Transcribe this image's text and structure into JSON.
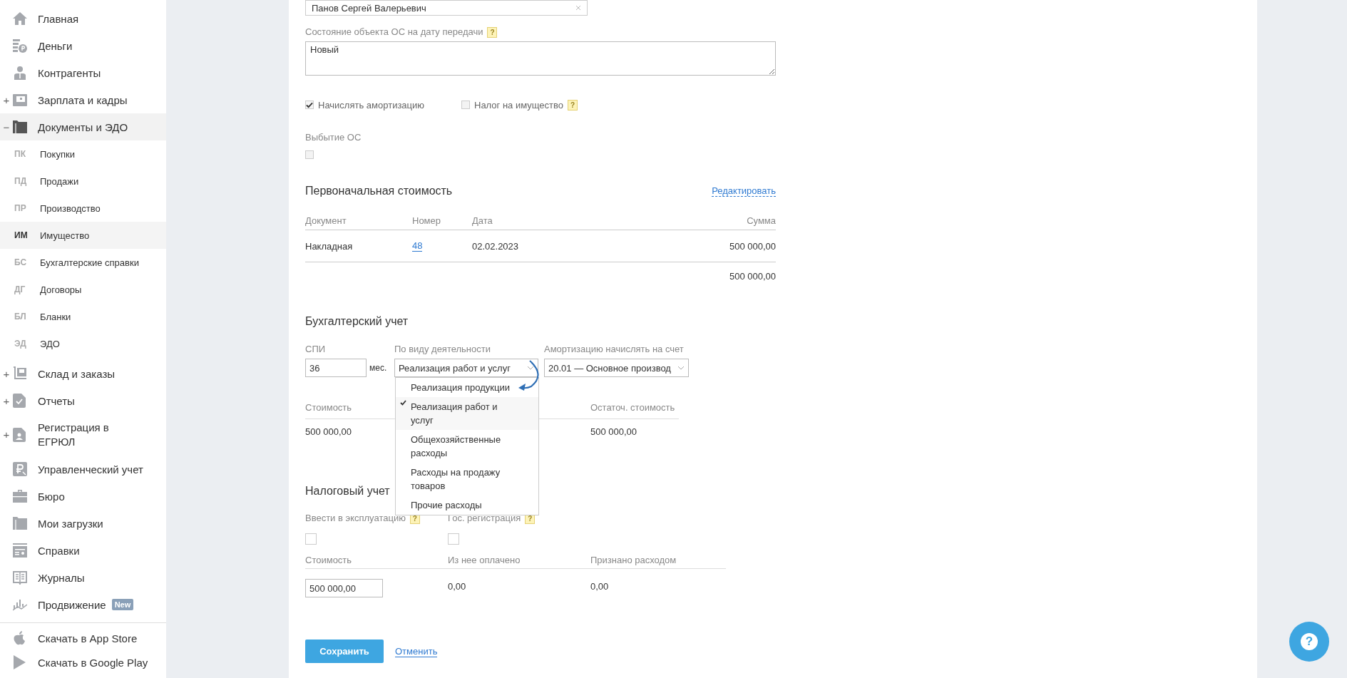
{
  "sidebar": {
    "items": [
      {
        "label": "Главная"
      },
      {
        "label": "Деньги"
      },
      {
        "label": "Контрагенты"
      },
      {
        "label": "Зарплата и кадры",
        "toggle": "+",
        "expanded": false
      },
      {
        "label": "Документы и ЭДО",
        "toggle": "−",
        "expanded": true,
        "children": [
          {
            "abbr": "ПК",
            "label": "Покупки",
            "selected": false
          },
          {
            "abbr": "ПД",
            "label": "Продажи",
            "selected": false
          },
          {
            "abbr": "ПР",
            "label": "Производство",
            "selected": false
          },
          {
            "abbr": "ИМ",
            "label": "Имущество",
            "selected": true
          },
          {
            "abbr": "БС",
            "label": "Бухгалтерские справки",
            "selected": false
          },
          {
            "abbr": "ДГ",
            "label": "Договоры",
            "selected": false
          },
          {
            "abbr": "БЛ",
            "label": "Бланки",
            "selected": false
          },
          {
            "abbr": "ЭД",
            "label": "ЭДО",
            "selected": false
          }
        ]
      },
      {
        "label": "Склад и заказы",
        "toggle": "+",
        "expanded": false
      },
      {
        "label": "Отчеты",
        "toggle": "+",
        "expanded": false
      },
      {
        "label": "Регистрация в ЕГРЮЛ",
        "toggle": "+",
        "expanded": false
      },
      {
        "label": "Управленческий учет"
      },
      {
        "label": "Бюро"
      },
      {
        "label": "Мои загрузки"
      },
      {
        "label": "Справки"
      },
      {
        "label": "Журналы"
      },
      {
        "label": "Продвижение",
        "badge": "New"
      }
    ],
    "store_links": [
      {
        "label": "Скачать в App Store"
      },
      {
        "label": "Скачать в Google Play"
      }
    ]
  },
  "form": {
    "responsible_field": {
      "value": "Панов Сергей Валерьевич"
    },
    "condition": {
      "label": "Состояние объекта ОС на дату передачи",
      "help": "?",
      "value": "Новый"
    },
    "options": [
      {
        "label": "Начислять амортизацию",
        "checked": true
      },
      {
        "label": "Налог на имущество",
        "checked": false,
        "help": "?"
      }
    ],
    "disposal": {
      "label": "Выбытие ОС",
      "checked": false
    },
    "initial_cost": {
      "title": "Первоначальная стоимость",
      "edit_link": "Редактировать",
      "columns": [
        "Документ",
        "Номер",
        "Дата",
        "Сумма"
      ],
      "rows": [
        {
          "document": "Накладная",
          "number": "48",
          "date": "02.02.2023",
          "sum": "500 000,00"
        }
      ],
      "total": "500 000,00"
    },
    "accounting": {
      "title": "Бухгалтерский учет",
      "spi": {
        "label": "СПИ",
        "value": "36",
        "unit": "мес."
      },
      "activity": {
        "label": "По виду деятельности",
        "value": "Реализация работ и услуг",
        "expanded": true,
        "options": [
          {
            "label": "Реализация продукции",
            "selected": false
          },
          {
            "label": "Реализация работ и услуг",
            "selected": true
          },
          {
            "label": "Общехозяйственные расходы",
            "selected": false
          },
          {
            "label": "Расходы на продажу товаров",
            "selected": false
          },
          {
            "label": "Прочие расходы",
            "selected": false
          }
        ]
      },
      "account": {
        "label": "Амортизацию начислять на счет",
        "value": "20.01 — Основное производ"
      },
      "columns": [
        "Стоимость",
        "Остаточ. стоимость"
      ],
      "values": [
        "500 000,00",
        "500 000,00"
      ]
    },
    "tax": {
      "title": "Налоговый учет",
      "checks": [
        {
          "label": "Ввести в эксплуатацию",
          "help": "?",
          "checked": false
        },
        {
          "label": "Гос. регистрация",
          "help": "?",
          "checked": false
        }
      ],
      "columns": [
        "Стоимость",
        "Из нее оплачено",
        "Признано расходом"
      ],
      "cost_value": "500 000,00",
      "values": [
        "0,00",
        "0,00"
      ]
    },
    "buttons": {
      "save": "Сохранить",
      "cancel": "Отменить"
    }
  },
  "help_button": {
    "label": "?"
  }
}
